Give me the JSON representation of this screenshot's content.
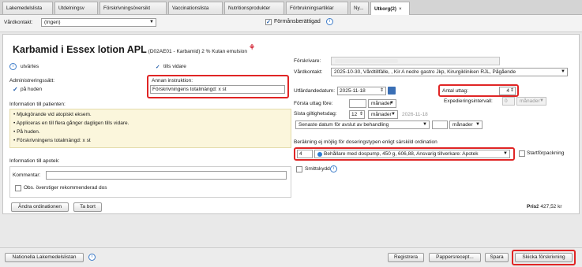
{
  "tabs": [
    {
      "label": "Lakemedelslista"
    },
    {
      "label": "Utdelningsv"
    },
    {
      "label": "Förskrivningsöversikt"
    },
    {
      "label": "Vaccinationslista"
    },
    {
      "label": "Nutritionsprodukter"
    },
    {
      "label": "Förbrukningsartiklar"
    },
    {
      "label": "Ny..."
    },
    {
      "label": "Utkorg(2)",
      "close": "×"
    }
  ],
  "filter": {
    "vardkontakt_label": "Vårdkontakt:",
    "vardkontakt_value": "(Ingen)",
    "formansberattigad_label": "Förmånsberättigad"
  },
  "drug": {
    "name": "Karbamid i Essex lotion APL",
    "details": "(D02AE01 - Karbamid) 2 % Kutan emulsion",
    "route": "utvärtes",
    "tills_vidare": "tills vidare",
    "admin_label": "Administreringssätt:",
    "admin_value": "på huden",
    "annan_label": "Annan instruktion:",
    "annan_value": "Förskrivningens totalmängd: x st",
    "patient_info_label": "Information till patienten:",
    "patient_info_lines": [
      "• Mjukgörande vid atopiskt eksem.",
      "• Appliceras en till flera gånger dagligen tills vidare.",
      "• På huden.",
      "• Förskrivningens totalmängd: x st"
    ],
    "apotek_label": "Information till apotek:",
    "kommentar_label": "Kommentar:",
    "obs_label": "Obs. överstiger rekommenderad dos",
    "andra_button": "Ändra ordinationen",
    "tabort_button": "Ta bort"
  },
  "right": {
    "forskrivare_label": "Förskrivare:",
    "vardkontakt_label": "Vårdkontakt:",
    "vardkontakt_value": "2025-10-30, Vårdtillfälle, , Kir A nedre gastro Jkp, Kirurgikliniken RJL, Pågående",
    "utfardandedatum_label": "Utfärdandedatum:",
    "utfardandedatum_value": "2025-11-18",
    "antal_uttag_label": "Antal uttag:",
    "antal_uttag_value": "4",
    "forsta_uttag_label": "Första uttag före:",
    "forsta_uttag_unit": "månader",
    "expedieringsintervall_label": "Expedieringsintervall:",
    "expedieringsintervall_value": "0",
    "expedieringsintervall_unit": "månader",
    "sista_label": "Sista giltighetsdag:",
    "sista_value": "12",
    "sista_unit": "månader",
    "sista_date": "2026-11-18",
    "senaste_value": "Senaste datum för avslut av behandling",
    "senaste_unit": "månader",
    "berakning_label": "Beräkning ej möjlig för doseringstypen enligt särskild ordination",
    "antal_value": "4",
    "package_value": "Behållare med dospump, 450 g, 606,88, Ansvarig tillverkare: Apotek",
    "startforpackning_label": "Startförpackning",
    "smittskydd_label": "Smittskydd",
    "pris_label": "Pris:",
    "pris_value": "2 427,52 kr"
  },
  "bottom": {
    "nll_button": "Nationella Lakemedelslistan",
    "registrera_button": "Registrera",
    "pappersrecept_button": "Pappersrecept...",
    "spara_button": "Spara",
    "skicka_button": "Skicka förskrivning"
  },
  "colors": {
    "highlight": "#e02525",
    "accent": "#1e5aa8",
    "note_bg": "#fbf6dc"
  }
}
